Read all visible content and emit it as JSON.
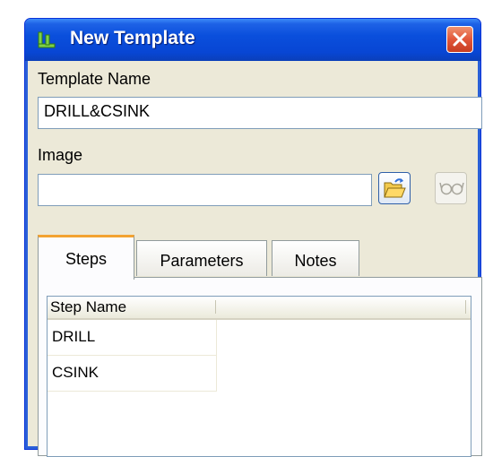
{
  "window": {
    "title": "New Template",
    "close_label": "Close"
  },
  "template_name": {
    "label": "Template Name",
    "value": "DRILL&CSINK"
  },
  "image": {
    "label": "Image",
    "value": "",
    "browse_icon": "open-folder-icon",
    "view_icon": "glasses-icon"
  },
  "tabs": [
    {
      "label": "Steps",
      "active": true
    },
    {
      "label": "Parameters",
      "active": false
    },
    {
      "label": "Notes",
      "active": false
    }
  ],
  "steps_list": {
    "columns": [
      "Step Name",
      ""
    ],
    "rows": [
      "DRILL",
      "CSINK"
    ]
  },
  "colors": {
    "titlebar": "#0a4fdc",
    "active_tab_accent": "#f3a332",
    "dialog_bg": "#ece9d8"
  }
}
